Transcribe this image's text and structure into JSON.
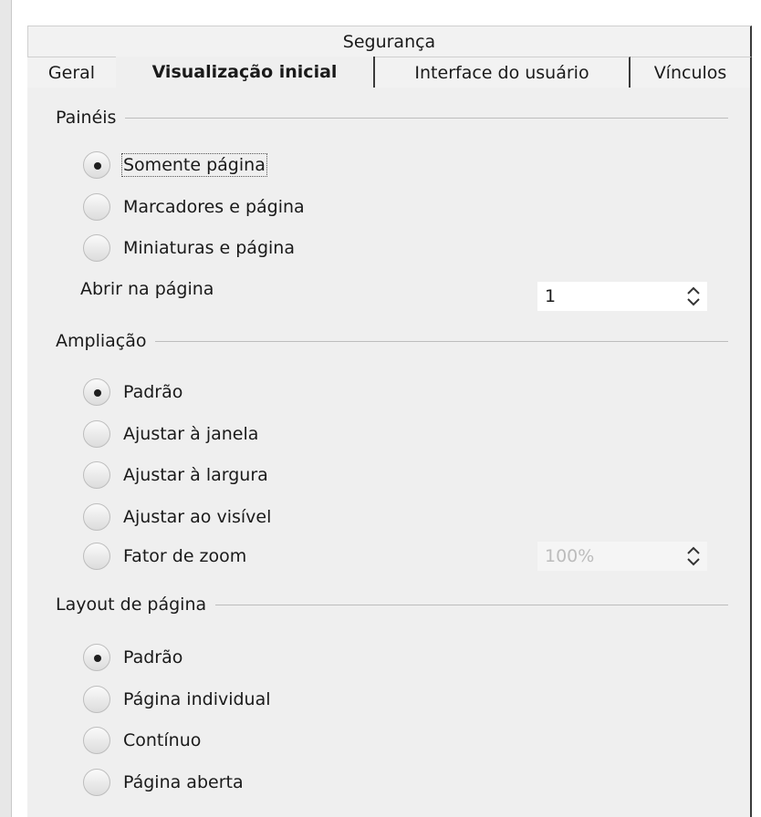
{
  "tabs_row1": [
    {
      "label": "Segurança"
    }
  ],
  "tabs_row2": [
    {
      "label": "Geral"
    },
    {
      "label": "Visualização inicial",
      "active": true
    },
    {
      "label": "Interface do usuário"
    },
    {
      "label": "Vínculos"
    }
  ],
  "paineis": {
    "title": "Painéis",
    "options": [
      {
        "label": "Somente página",
        "selected": true
      },
      {
        "label": "Marcadores e página",
        "selected": false
      },
      {
        "label": "Miniaturas e página",
        "selected": false
      }
    ],
    "open_page_label": "Abrir na página",
    "open_page_value": "1"
  },
  "ampliacao": {
    "title": "Ampliação",
    "options": [
      {
        "label": "Padrão",
        "selected": true
      },
      {
        "label": "Ajustar à janela",
        "selected": false
      },
      {
        "label": "Ajustar à largura",
        "selected": false
      },
      {
        "label": "Ajustar ao visível",
        "selected": false
      },
      {
        "label": "Fator de zoom",
        "selected": false
      }
    ],
    "zoom_value": "100%"
  },
  "layout": {
    "title": "Layout de página",
    "options": [
      {
        "label": "Padrão",
        "selected": true
      },
      {
        "label": "Página individual",
        "selected": false
      },
      {
        "label": "Contínuo",
        "selected": false
      },
      {
        "label": "Página aberta",
        "selected": false
      }
    ]
  },
  "icons": {
    "spin": "chevron-up-down-icon",
    "radio": "radio-button"
  }
}
